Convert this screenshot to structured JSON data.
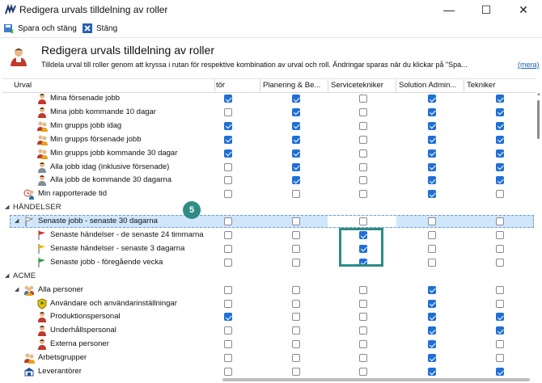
{
  "window": {
    "title": "Redigera urvals tilldelning av roller",
    "minimize": "—",
    "maximize": "☐",
    "close": "✕"
  },
  "toolbar": {
    "save_close": "Spara och stäng",
    "close": "Stäng"
  },
  "header": {
    "title": "Redigera urvals tilldelning av roller",
    "description": "Tilldela urval till roller genom att kryssa i rutan för respektive kombination av urval och roll. Ändringar sparas när du klickar på \"Spa...",
    "more": "(mera)"
  },
  "columns": {
    "urval": "Urval",
    "c1": "tör",
    "c2": "Planering & Be...",
    "c3": "Servicetekniker",
    "c4": "Solution Admin...",
    "c5": "Tekniker"
  },
  "badge": "5",
  "rows": [
    {
      "label": "Mina försenade jobb",
      "icon": "person-icon",
      "checks": [
        true,
        true,
        false,
        true,
        true
      ]
    },
    {
      "label": "Mina jobb kommande 10 dagar",
      "icon": "person-icon",
      "checks": [
        false,
        true,
        false,
        true,
        true
      ]
    },
    {
      "label": "Min grupps jobb idag",
      "icon": "group-icon",
      "checks": [
        true,
        true,
        false,
        true,
        true
      ]
    },
    {
      "label": "Min grupps försenade jobb",
      "icon": "group-icon",
      "checks": [
        true,
        true,
        false,
        true,
        true
      ]
    },
    {
      "label": "Min grupps jobb kommande 30 dagar",
      "icon": "group-icon",
      "checks": [
        true,
        true,
        false,
        true,
        true
      ]
    },
    {
      "label": "Alla jobb idag (inklusive försenade)",
      "icon": "person-gray-icon",
      "checks": [
        false,
        true,
        false,
        true,
        true
      ]
    },
    {
      "label": "Alla jobb de kommande 30 dagarna",
      "icon": "person-gray-icon",
      "checks": [
        false,
        true,
        false,
        true,
        true
      ]
    },
    {
      "label": "Min rapporterade tid",
      "icon": "clock-person-icon",
      "checks": [
        false,
        false,
        false,
        true,
        false
      ]
    },
    {
      "label": "HÄNDELSER",
      "section": true
    },
    {
      "label": "Senaste jobb - senaste 30 dagarna",
      "icon": "flag-icon",
      "selected": true,
      "checks": [
        false,
        false,
        false,
        false,
        false
      ]
    },
    {
      "label": "Senaste händelser - de senaste 24 timmarna",
      "icon": "flag-red-icon",
      "checks": [
        false,
        false,
        true,
        false,
        false
      ]
    },
    {
      "label": "Senaste händelser - senaste 3 dagarna",
      "icon": "flag-yellow-icon",
      "checks": [
        false,
        false,
        true,
        false,
        false
      ]
    },
    {
      "label": "Senaste jobb - föregående vecka",
      "icon": "flag-green-icon",
      "checks": [
        false,
        false,
        true,
        false,
        false
      ]
    },
    {
      "label": "ACME",
      "section": true
    },
    {
      "label": "Alla personer",
      "icon": "people-icon",
      "checks": [
        false,
        false,
        false,
        true,
        false
      ]
    },
    {
      "label": "Användare och användarinställningar",
      "icon": "shield-icon",
      "checks": [
        false,
        false,
        false,
        true,
        false
      ]
    },
    {
      "label": "Produktionspersonal",
      "icon": "person-icon",
      "checks": [
        true,
        false,
        false,
        true,
        true
      ]
    },
    {
      "label": "Underhållspersonal",
      "icon": "person-icon",
      "checks": [
        false,
        false,
        false,
        true,
        true
      ]
    },
    {
      "label": "Externa personer",
      "icon": "person-icon",
      "checks": [
        false,
        false,
        false,
        true,
        false
      ]
    },
    {
      "label": "Arbetsgrupper",
      "icon": "group-icon",
      "checks": [
        false,
        false,
        false,
        true,
        false
      ]
    },
    {
      "label": "Leverantörer",
      "icon": "truck-icon",
      "checks": [
        false,
        false,
        false,
        true,
        true
      ]
    }
  ]
}
